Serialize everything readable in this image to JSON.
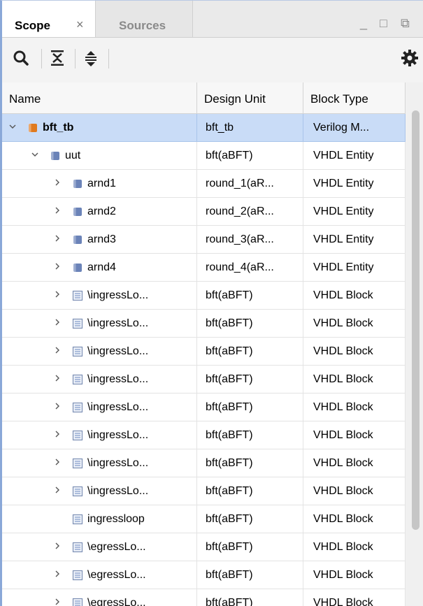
{
  "tabs": {
    "scope": "Scope",
    "close": "×",
    "sources": "Sources"
  },
  "window_controls": [
    "_",
    "□",
    "⧉"
  ],
  "toolbar": {
    "icons": [
      "search-icon",
      "collapse-all-icon",
      "expand-all-icon",
      "gear-icon"
    ]
  },
  "columns": [
    "Name",
    "Design Unit",
    "Block Type"
  ],
  "rows": [
    {
      "name": "bft_tb",
      "design_unit": "bft_tb",
      "block_type": "Verilog M...",
      "level": 0,
      "expander": "expanded",
      "icon": "verilog-module-icon",
      "selected": true,
      "bold": true
    },
    {
      "name": "uut",
      "design_unit": "bft(aBFT)",
      "block_type": "VHDL Entity",
      "level": 1,
      "expander": "expanded",
      "icon": "vhdl-entity-icon"
    },
    {
      "name": "arnd1",
      "design_unit": "round_1(aR...",
      "block_type": "VHDL Entity",
      "level": 2,
      "expander": "collapsed",
      "icon": "vhdl-entity-icon"
    },
    {
      "name": "arnd2",
      "design_unit": "round_2(aR...",
      "block_type": "VHDL Entity",
      "level": 2,
      "expander": "collapsed",
      "icon": "vhdl-entity-icon"
    },
    {
      "name": "arnd3",
      "design_unit": "round_3(aR...",
      "block_type": "VHDL Entity",
      "level": 2,
      "expander": "collapsed",
      "icon": "vhdl-entity-icon"
    },
    {
      "name": "arnd4",
      "design_unit": "round_4(aR...",
      "block_type": "VHDL Entity",
      "level": 2,
      "expander": "collapsed",
      "icon": "vhdl-entity-icon"
    },
    {
      "name": "\\ingressLo...",
      "design_unit": "bft(aBFT)",
      "block_type": "VHDL Block",
      "level": 2,
      "expander": "collapsed",
      "icon": "vhdl-block-icon"
    },
    {
      "name": "\\ingressLo...",
      "design_unit": "bft(aBFT)",
      "block_type": "VHDL Block",
      "level": 2,
      "expander": "collapsed",
      "icon": "vhdl-block-icon"
    },
    {
      "name": "\\ingressLo...",
      "design_unit": "bft(aBFT)",
      "block_type": "VHDL Block",
      "level": 2,
      "expander": "collapsed",
      "icon": "vhdl-block-icon"
    },
    {
      "name": "\\ingressLo...",
      "design_unit": "bft(aBFT)",
      "block_type": "VHDL Block",
      "level": 2,
      "expander": "collapsed",
      "icon": "vhdl-block-icon"
    },
    {
      "name": "\\ingressLo...",
      "design_unit": "bft(aBFT)",
      "block_type": "VHDL Block",
      "level": 2,
      "expander": "collapsed",
      "icon": "vhdl-block-icon"
    },
    {
      "name": "\\ingressLo...",
      "design_unit": "bft(aBFT)",
      "block_type": "VHDL Block",
      "level": 2,
      "expander": "collapsed",
      "icon": "vhdl-block-icon"
    },
    {
      "name": "\\ingressLo...",
      "design_unit": "bft(aBFT)",
      "block_type": "VHDL Block",
      "level": 2,
      "expander": "collapsed",
      "icon": "vhdl-block-icon"
    },
    {
      "name": "\\ingressLo...",
      "design_unit": "bft(aBFT)",
      "block_type": "VHDL Block",
      "level": 2,
      "expander": "collapsed",
      "icon": "vhdl-block-icon"
    },
    {
      "name": "ingressloop",
      "design_unit": "bft(aBFT)",
      "block_type": "VHDL Block",
      "level": 2,
      "expander": "none",
      "icon": "vhdl-block-icon"
    },
    {
      "name": "\\egressLo...",
      "design_unit": "bft(aBFT)",
      "block_type": "VHDL Block",
      "level": 2,
      "expander": "collapsed",
      "icon": "vhdl-block-icon"
    },
    {
      "name": "\\egressLo...",
      "design_unit": "bft(aBFT)",
      "block_type": "VHDL Block",
      "level": 2,
      "expander": "collapsed",
      "icon": "vhdl-block-icon"
    },
    {
      "name": "\\egressLo...",
      "design_unit": "bft(aBFT)",
      "block_type": "VHDL Block",
      "level": 2,
      "expander": "collapsed",
      "icon": "vhdl-block-icon"
    }
  ],
  "colors": {
    "selection": "#c9dcf7",
    "verilog_icon": "#e07a1f",
    "entity_icon": "#6b83b8",
    "block_icon": "#8fa6cf"
  }
}
